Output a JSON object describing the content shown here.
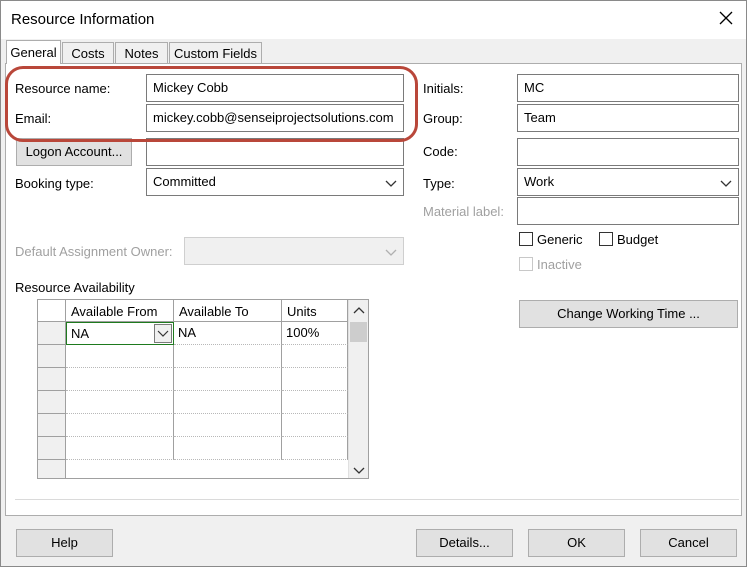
{
  "dialog": {
    "title": "Resource Information"
  },
  "tabs": [
    {
      "label": "General",
      "active": true
    },
    {
      "label": "Costs",
      "active": false
    },
    {
      "label": "Notes",
      "active": false
    },
    {
      "label": "Custom Fields",
      "active": false
    }
  ],
  "general": {
    "resource_name": {
      "label": "Resource name:",
      "value": "Mickey Cobb"
    },
    "email": {
      "label": "Email:",
      "value": "mickey.cobb@senseiprojectsolutions.com"
    },
    "logon_button": "Logon Account...",
    "logon_value": "",
    "booking_type": {
      "label": "Booking type:",
      "value": "Committed"
    },
    "default_owner": {
      "label": "Default Assignment Owner:",
      "value": ""
    },
    "initials": {
      "label": "Initials:",
      "value": "MC"
    },
    "group": {
      "label": "Group:",
      "value": "Team"
    },
    "code": {
      "label": "Code:",
      "value": ""
    },
    "type": {
      "label": "Type:",
      "value": "Work"
    },
    "material_label": {
      "label": "Material label:",
      "value": ""
    },
    "generic": {
      "label": "Generic",
      "checked": false
    },
    "budget": {
      "label": "Budget",
      "checked": false
    },
    "inactive": {
      "label": "Inactive",
      "checked": false
    },
    "change_working_time": "Change Working Time ..."
  },
  "availability": {
    "title": "Resource Availability",
    "columns": [
      "Available From",
      "Available To",
      "Units"
    ],
    "rows": [
      [
        "NA",
        "NA",
        "100%"
      ],
      [
        "",
        "",
        ""
      ],
      [
        "",
        "",
        ""
      ],
      [
        "",
        "",
        ""
      ],
      [
        "",
        "",
        ""
      ],
      [
        "",
        "",
        ""
      ]
    ]
  },
  "footer": {
    "help": "Help",
    "details": "Details...",
    "ok": "OK",
    "cancel": "Cancel"
  },
  "icons": {
    "close": "close-icon",
    "dropdown": "chevron-down-icon",
    "scroll_down": "scroll-down-arrow-icon"
  },
  "colors": {
    "highlight_ring": "#b9473a",
    "selected_cell_border": "#1e7a1e"
  }
}
